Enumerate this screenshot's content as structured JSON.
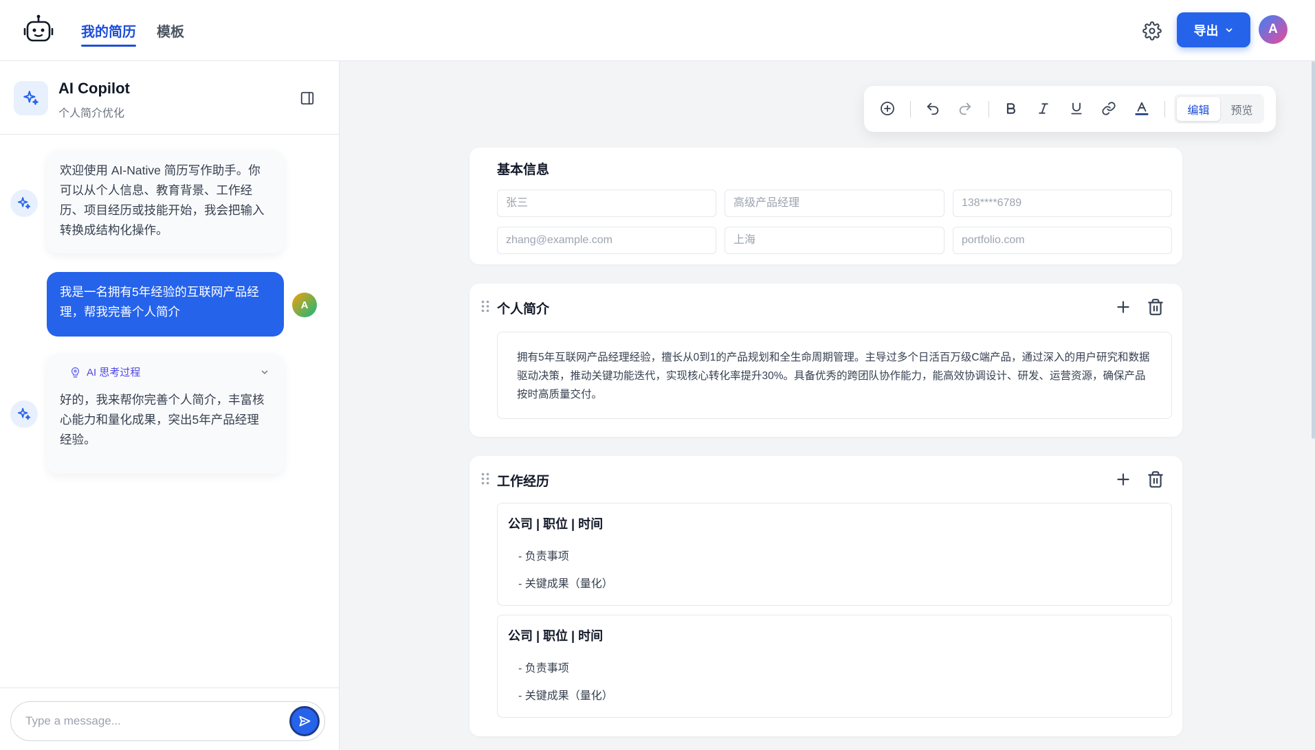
{
  "header": {
    "tabs": [
      {
        "label": "我的简历",
        "active": true
      },
      {
        "label": "模板",
        "active": false
      }
    ],
    "export_label": "导出",
    "avatar_initial": "A"
  },
  "sidebar": {
    "title": "AI Copilot",
    "subtitle": "个人简介优化",
    "messages": [
      {
        "role": "ai",
        "text": "欢迎使用 AI-Native 简历写作助手。你可以从个人信息、教育背景、工作经历、项目经历或技能开始，我会把输入转换成结构化操作。"
      },
      {
        "role": "user",
        "text": "我是一名拥有5年经验的互联网产品经理，帮我完善个人简介",
        "avatar": "A"
      },
      {
        "role": "ai",
        "thinking_label": "AI 思考过程",
        "text": "好的，我来帮你完善个人简介，丰富核心能力和量化成果，突出5年产品经理经验。"
      }
    ],
    "input_placeholder": "Type a message..."
  },
  "toolbar": {
    "mode_edit": "编辑",
    "mode_preview": "预览",
    "active_mode": "编辑"
  },
  "basic_info": {
    "title": "基本信息",
    "fields": {
      "name": {
        "placeholder": "张三"
      },
      "title": {
        "placeholder": "高级产品经理"
      },
      "phone": {
        "placeholder": "138****6789"
      },
      "email": {
        "placeholder": "zhang@example.com"
      },
      "city": {
        "placeholder": "上海"
      },
      "site": {
        "placeholder": "portfolio.com"
      }
    }
  },
  "summary": {
    "title": "个人简介",
    "text": "拥有5年互联网产品经理经验，擅长从0到1的产品规划和全生命周期管理。主导过多个日活百万级C端产品，通过深入的用户研究和数据驱动决策，推动关键功能迭代，实现核心转化率提升30%。具备优秀的跨团队协作能力，能高效协调设计、研发、运营资源，确保产品按时高质量交付。"
  },
  "work": {
    "title": "工作经历",
    "entries": [
      {
        "heading": "公司 | 职位 | 时间",
        "lines": [
          "- 负责事项",
          "- 关键成果（量化）"
        ]
      },
      {
        "heading": "公司 | 职位 | 时间",
        "lines": [
          "- 负责事项",
          "- 关键成果（量化）"
        ]
      }
    ]
  },
  "colors": {
    "accent": "#2563eb",
    "background": "#f3f4f6",
    "card": "#ffffff"
  }
}
